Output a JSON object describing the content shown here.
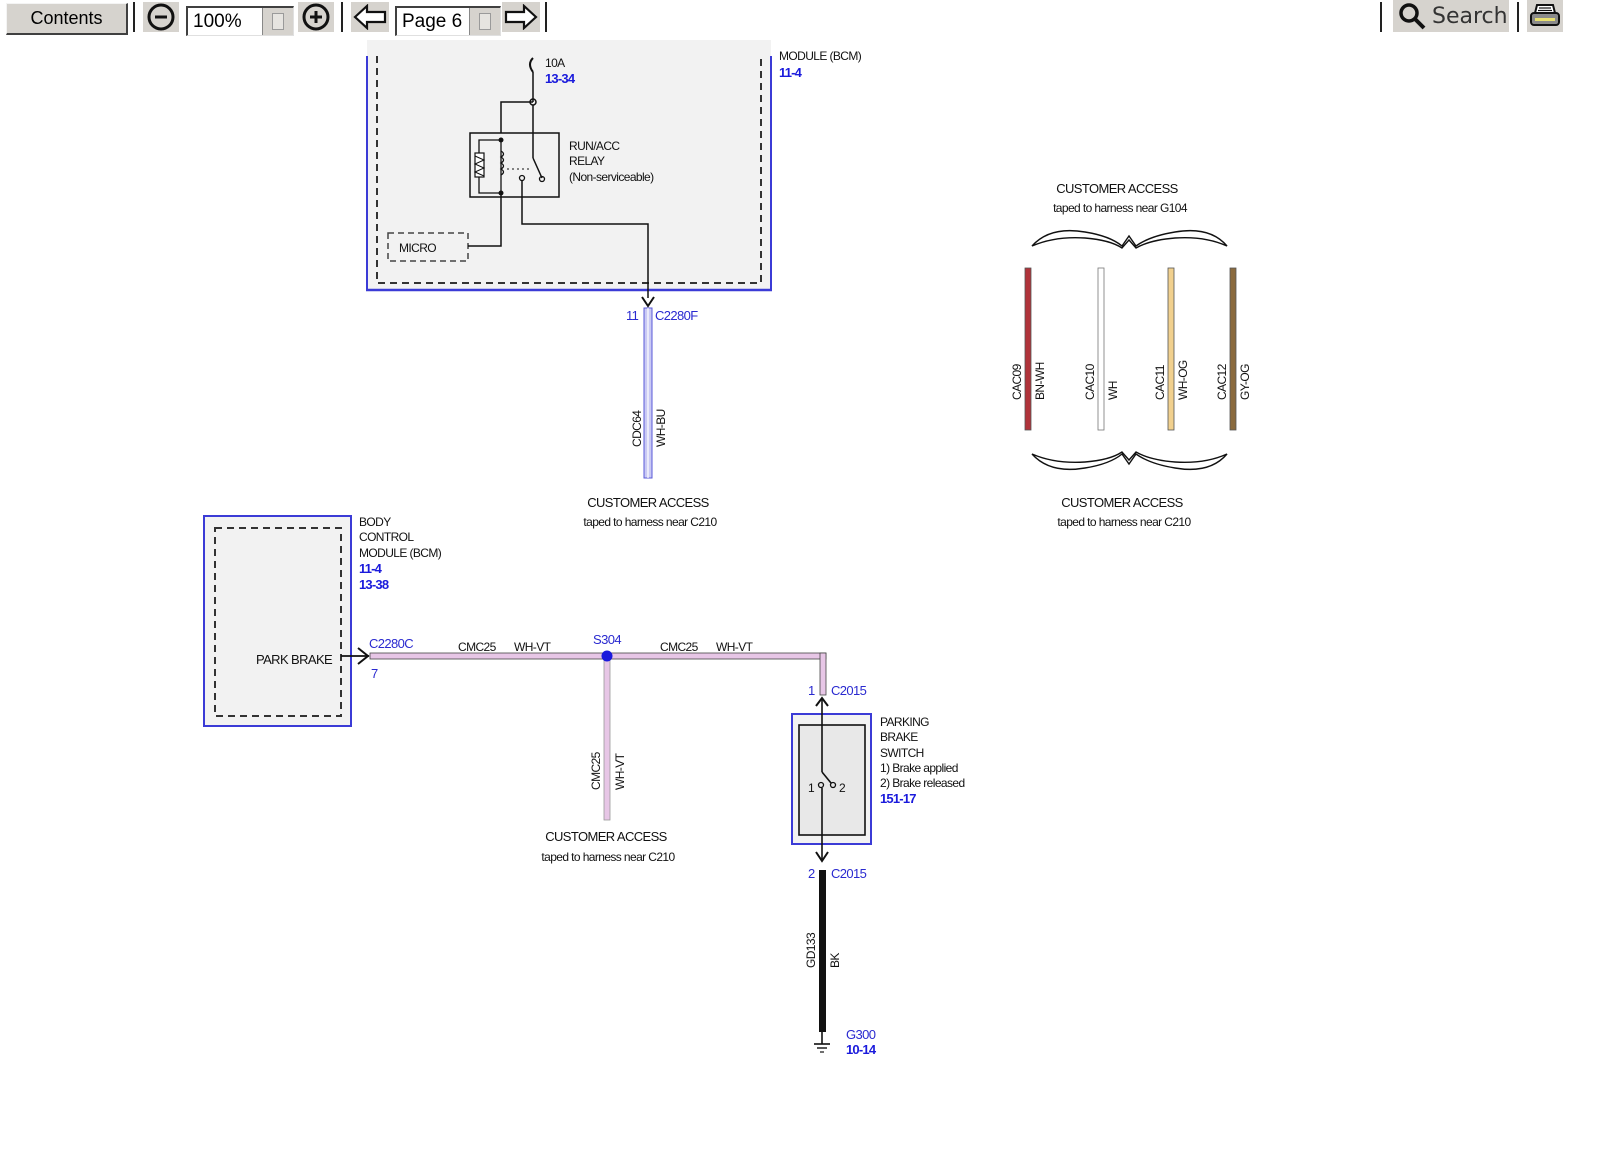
{
  "toolbar": {
    "contents_label": "Contents",
    "zoom_value": "100%",
    "page_value": "Page 6",
    "search_label": "Search",
    "icons": {
      "zoom_out": "zoom-out-icon",
      "zoom_in": "zoom-in-icon",
      "prev_page": "arrow-left-icon",
      "next_page": "arrow-right-icon",
      "search": "magnifier-icon",
      "print": "printer-icon"
    }
  },
  "diagram": {
    "top_module": {
      "title_partial": "MODULE (BCM)",
      "ref": "11-4",
      "fuse_label": "10A",
      "fuse_ref": "13-34",
      "relay_lines": [
        "RUN/ACC",
        "RELAY",
        "(Non-serviceable)"
      ],
      "micro_label": "MICRO"
    },
    "connector_c2280f": {
      "pin": "11",
      "name": "C2280F"
    },
    "wire_cdc64": {
      "circuit": "CDC64",
      "color": "WH-BU"
    },
    "access_c210_top": {
      "title": "CUSTOMER ACCESS",
      "subtitle": "taped to harness near C210"
    },
    "access_g104": {
      "title": "CUSTOMER ACCESS",
      "subtitle": "taped to harness near G104",
      "bottom_title": "CUSTOMER ACCESS",
      "bottom_subtitle": "taped to harness near C210",
      "wires": [
        {
          "circuit": "CAC09",
          "color": "BN-WH",
          "hex": "#b0333a"
        },
        {
          "circuit": "CAC10",
          "color": "WH",
          "hex": "#ffffff"
        },
        {
          "circuit": "CAC11",
          "color": "WH-OG",
          "hex": "#f1d08e"
        },
        {
          "circuit": "CAC12",
          "color": "GY-OG",
          "hex": "#8a6a3e"
        }
      ]
    },
    "bcm": {
      "title_lines": [
        "BODY",
        "CONTROL",
        "MODULE (BCM)"
      ],
      "refs": [
        "11-4",
        "13-38"
      ],
      "inner_label": "PARK BRAKE",
      "connector": "C2280C",
      "pin": "7"
    },
    "wire_cmc25": {
      "left": {
        "circuit": "CMC25",
        "color": "WH-VT"
      },
      "right": {
        "circuit": "CMC25",
        "color": "WH-VT"
      },
      "branch": {
        "circuit": "CMC25",
        "color": "WH-VT"
      },
      "splice": "S304"
    },
    "access_c210_mid": {
      "title": "CUSTOMER ACCESS",
      "subtitle": "taped to harness near C210"
    },
    "parking_switch": {
      "title_lines": [
        "PARKING",
        "BRAKE",
        "SWITCH",
        "1) Brake applied",
        "2) Brake released"
      ],
      "ref": "151-17",
      "pin_left": "1",
      "pin_right": "2",
      "top_connector": {
        "pin": "1",
        "name": "C2015"
      },
      "bottom_connector": {
        "pin": "2",
        "name": "C2015"
      }
    },
    "wire_gd133": {
      "circuit": "GD133",
      "color": "BK"
    },
    "ground": {
      "name": "G300",
      "ref": "10-14"
    },
    "colors": {
      "module_border": "#3b3bd6",
      "ref_blue": "#1a1adc",
      "module_fill": "#f2f2f2",
      "wire_wh_vt": "#e7c6e6",
      "wire_wh_bu": "#c9c9f4"
    }
  }
}
